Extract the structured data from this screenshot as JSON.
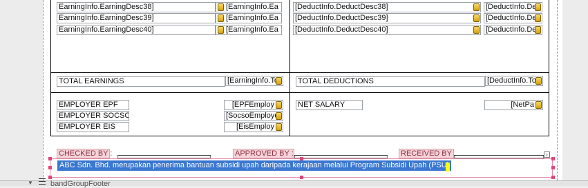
{
  "earnings": {
    "rows": [
      {
        "desc": "EarningInfo.EarningDesc38]",
        "amount": "[EarningInfo.Ea"
      },
      {
        "desc": "EarningInfo.EarningDesc39]",
        "amount": "[EarningInfo.Ea"
      },
      {
        "desc": "EarningInfo.EarningDesc40]",
        "amount": "[EarningInfo.Ea"
      }
    ],
    "total_label": "TOTAL EARNINGS",
    "total_value": "[EarningInfo.To"
  },
  "deductions": {
    "rows": [
      {
        "desc": "[DeductInfo.DeductDesc38]",
        "amount": "[DeductInfo.De"
      },
      {
        "desc": "[DeductInfo.DeductDesc39]",
        "amount": "[DeductInfo.De"
      },
      {
        "desc": "[DeductInfo.DeductDesc40]",
        "amount": "[DeductInfo.De"
      }
    ],
    "total_label": "TOTAL DEDUCTIONS",
    "total_value": "[DeductInfo.To"
  },
  "employer": {
    "epf_label": "EMPLOYER EPF",
    "epf_value": "[EPFEmploy",
    "socso_label": "EMPLOYER SOCSO",
    "socso_value": "[SocsoEmploye",
    "eis_label": "EMPLOYER EIS",
    "eis_value": "[EisEmploy"
  },
  "net": {
    "label": "NET SALARY",
    "value": "[NetPa"
  },
  "signatures": {
    "checked_by": "CHECKED BY :",
    "approved_by": "APPROVED BY :",
    "received_by": "RECEIVED BY"
  },
  "footer_note": "ABC Sdn. Bhd. merupakan penerima bantuan subsidi upah daripada kerajaan melalui Program Subsidi Upah (PSU)",
  "band": {
    "name": "bandGroupFooter"
  },
  "colors": {
    "selection": "#3a77d1",
    "label_bg": "#f6d4da",
    "handle": "#e0447a",
    "db_icon": "#e0b226"
  }
}
